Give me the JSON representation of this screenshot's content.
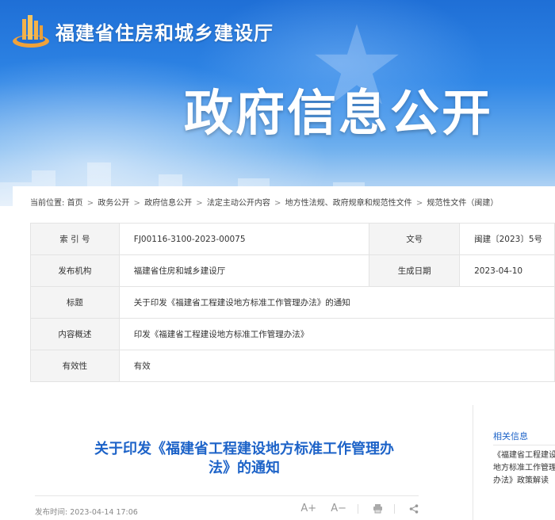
{
  "header": {
    "site_name": "福建省住房和城乡建设厅",
    "banner_title": "政府信息公开",
    "logo": "福建住建 logo-icon"
  },
  "breadcrumb": {
    "prefix": "当前位置:",
    "items": [
      "首页",
      "政务公开",
      "政府信息公开",
      "法定主动公开内容",
      "地方性法规、政府规章和规范性文件",
      "规范性文件（闽建）"
    ],
    "separator": ">"
  },
  "meta": {
    "index_label": "索 引 号",
    "index_value": "FJ00116-3100-2023-00075",
    "doc_no_label": "文号",
    "doc_no_value": "闽建〔2023〕5号",
    "issuer_label": "发布机构",
    "issuer_value": "福建省住房和城乡建设厅",
    "date_label": "生成日期",
    "date_value": "2023-04-10",
    "title_label": "标题",
    "title_value": "关于印发《福建省工程建设地方标准工作管理办法》的通知",
    "summary_label": "内容概述",
    "summary_value": "印发《福建省工程建设地方标准工作管理办法》",
    "validity_label": "有效性",
    "validity_value": "有效"
  },
  "article": {
    "title": "关于印发《福建省工程建设地方标准工作管理办法》的通知",
    "published_label": "发布时间:",
    "published_value": "2023-04-14 17:06",
    "tools": {
      "font_increase": "A+",
      "font_decrease": "A−"
    }
  },
  "side": {
    "title": "相关信息",
    "items": [
      "《福建省工程建设地方标准工作管理办法》政策解读"
    ]
  },
  "colors": {
    "brand_blue": "#1d63c8",
    "banner_top": "#1f6fd6",
    "label_bg": "#f4f4f4",
    "border": "#e3e3e3"
  }
}
